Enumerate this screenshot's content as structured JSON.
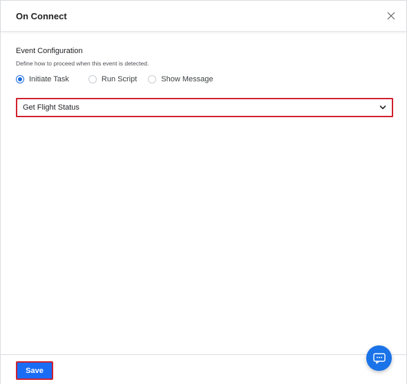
{
  "dialog": {
    "title": "On Connect",
    "close_icon": "close-icon"
  },
  "event_config": {
    "title": "Event Configuration",
    "description": "Define how to proceed when this event is detected.",
    "options": [
      {
        "label": "Initiate Task",
        "checked": true
      },
      {
        "label": "Run Script",
        "checked": false
      },
      {
        "label": "Show Message",
        "checked": false
      }
    ],
    "task_select": {
      "selected": "Get Flight Status",
      "icon": "chevron-down-icon"
    }
  },
  "footer": {
    "save_label": "Save"
  },
  "chat": {
    "icon": "chat-icon"
  },
  "colors": {
    "primary": "#1a6cf5",
    "highlight": "#d0202f",
    "radio_active": "#1a6cd9"
  }
}
